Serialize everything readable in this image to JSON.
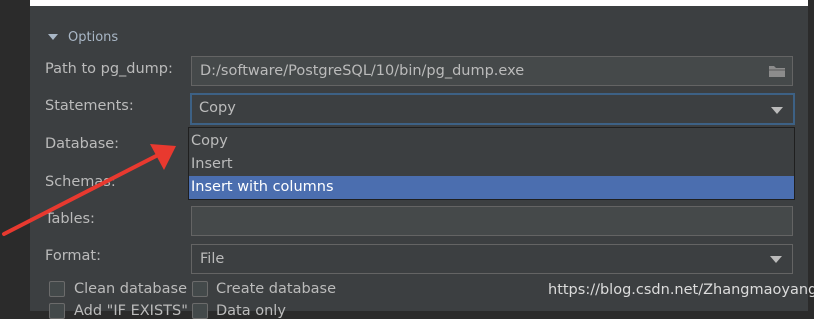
{
  "options": {
    "section_title": "Options"
  },
  "fields": {
    "path_label": "Path to pg_dump:",
    "path_value": "D:/software/PostgreSQL/10/bin/pg_dump.exe",
    "statements_label": "Statements:",
    "statements_value": "Copy",
    "database_label": "Database:",
    "schemas_label": "Schemas:",
    "tables_label": "Tables:",
    "format_label": "Format:",
    "format_value": "File"
  },
  "dropdown": {
    "items": [
      {
        "label": "Copy"
      },
      {
        "label": "Insert"
      },
      {
        "label": "Insert with columns"
      }
    ],
    "selected_index": 2
  },
  "checkboxes": {
    "clean_database": "Clean database",
    "create_database": "Create database",
    "add_if_exists": "Add \"IF EXISTS\"",
    "data_only": "Data only"
  },
  "watermark": "https://blog.csdn.net/Zhangmaoyang",
  "colors": {
    "background": "#3c3f41",
    "selection": "#4b6eaf",
    "annotation_arrow": "#e8392f",
    "focus_border": "#3d6185"
  },
  "icons": [
    "triangle-down-icon",
    "folder-icon",
    "chevron-down-icon",
    "annotation-arrow-icon"
  ]
}
